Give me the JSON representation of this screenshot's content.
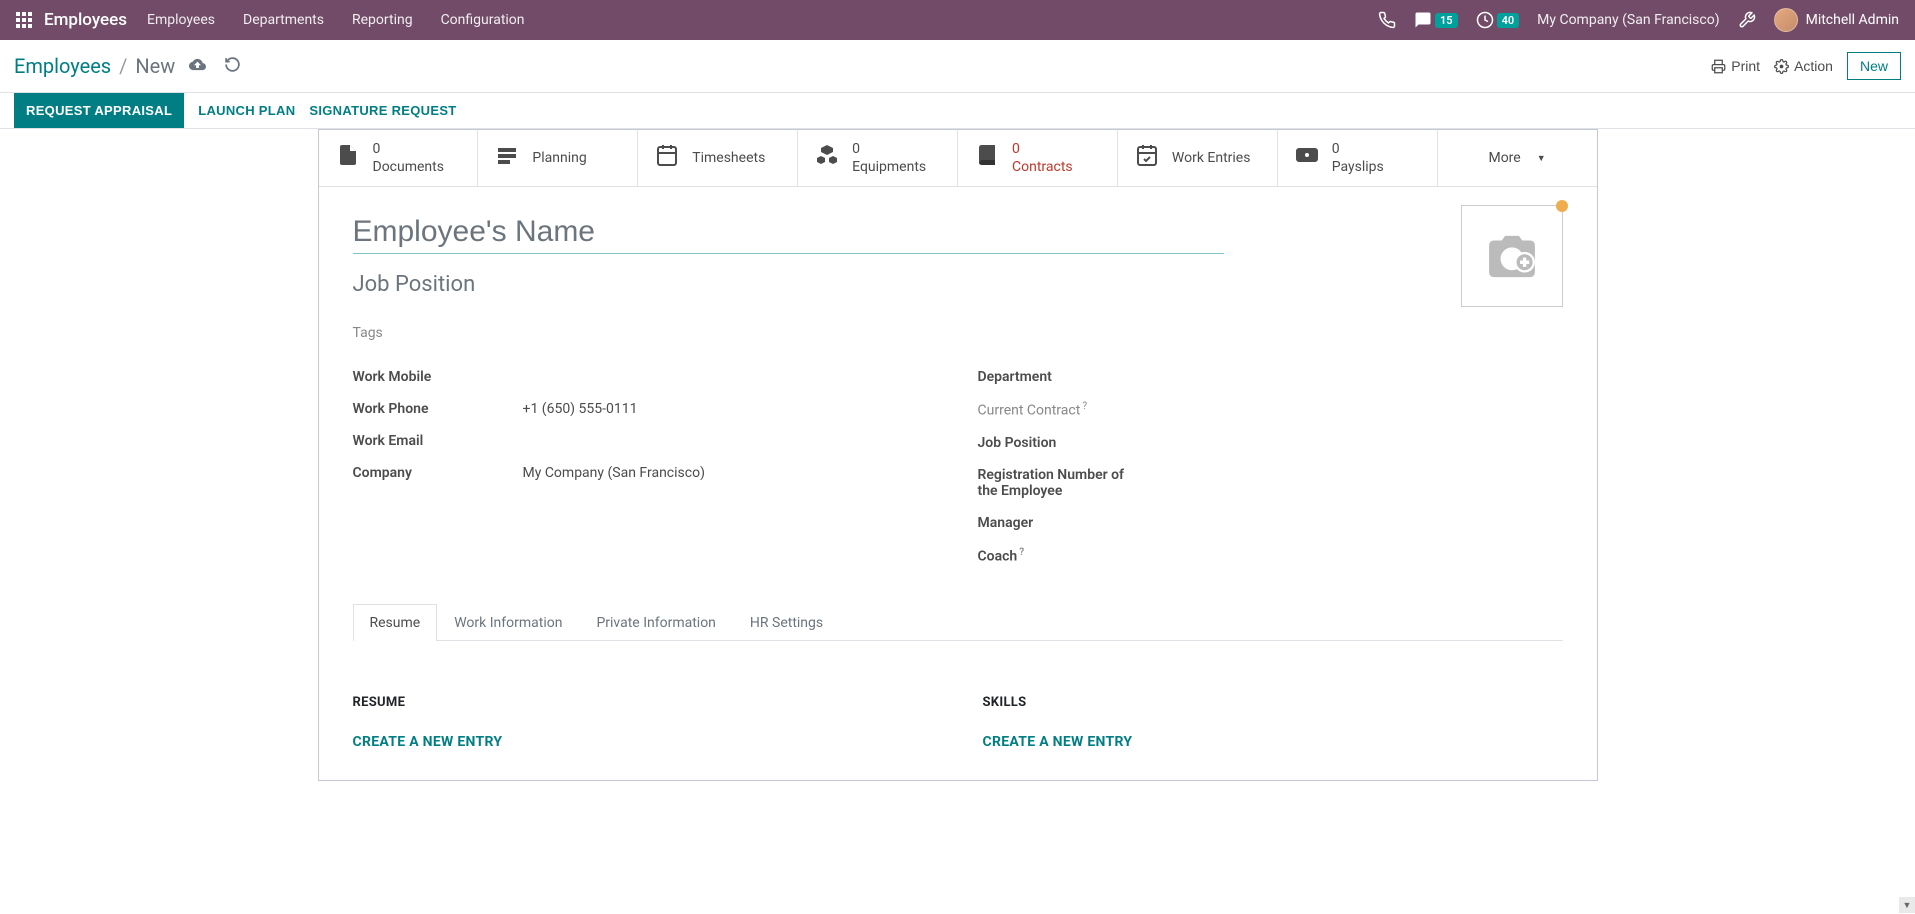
{
  "navbar": {
    "brand": "Employees",
    "menu": [
      "Employees",
      "Departments",
      "Reporting",
      "Configuration"
    ],
    "messages_count": "15",
    "activities_count": "40",
    "company": "My Company (San Francisco)",
    "user": "Mitchell Admin"
  },
  "control_panel": {
    "breadcrumb_root": "Employees",
    "breadcrumb_current": "New",
    "print_label": "Print",
    "action_label": "Action",
    "new_label": "New"
  },
  "status_bar": {
    "request_appraisal": "REQUEST APPRAISAL",
    "launch_plan": "LAUNCH PLAN",
    "signature_request": "SIGNATURE REQUEST"
  },
  "stat_buttons": {
    "documents": {
      "count": "0",
      "label": "Documents"
    },
    "planning": {
      "label": "Planning"
    },
    "timesheets": {
      "label": "Timesheets"
    },
    "equipments": {
      "count": "0",
      "label": "Equipments"
    },
    "contracts": {
      "count": "0",
      "label": "Contracts"
    },
    "work_entries": {
      "label": "Work Entries"
    },
    "payslips": {
      "count": "0",
      "label": "Payslips"
    },
    "more": "More"
  },
  "form": {
    "name_placeholder": "Employee's Name",
    "job_position_placeholder": "Job Position",
    "tags_placeholder": "Tags",
    "left_fields": {
      "work_mobile": "Work Mobile",
      "work_phone": "Work Phone",
      "work_phone_value": "+1 (650) 555-0111",
      "work_email": "Work Email",
      "company": "Company",
      "company_value": "My Company (San Francisco)"
    },
    "right_fields": {
      "department": "Department",
      "current_contract": "Current Contract",
      "job_position": "Job Position",
      "registration": "Registration Number of the Employee",
      "manager": "Manager",
      "coach": "Coach"
    }
  },
  "tabs": [
    "Resume",
    "Work Information",
    "Private Information",
    "HR Settings"
  ],
  "tab_content": {
    "resume_title": "RESUME",
    "skills_title": "SKILLS",
    "create_entry": "CREATE A NEW ENTRY"
  }
}
